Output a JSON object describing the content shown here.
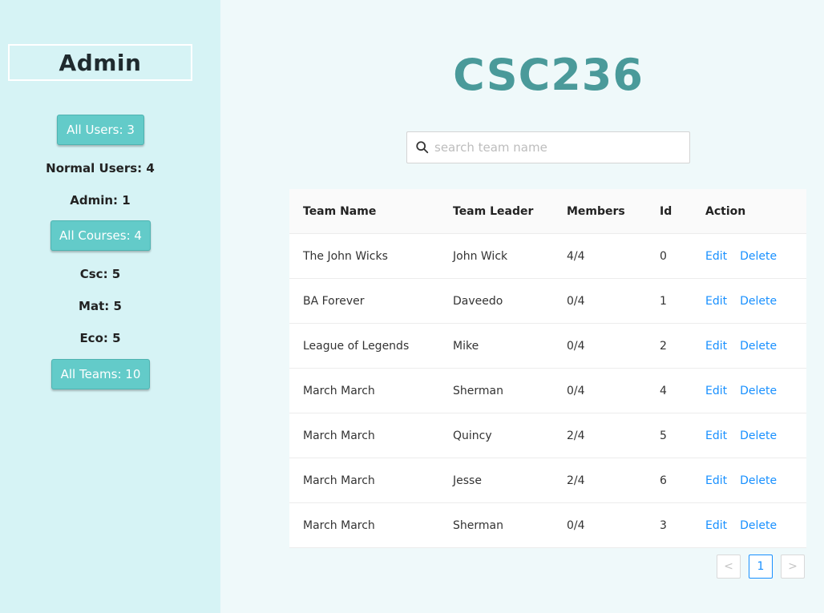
{
  "sidebar": {
    "title": "Admin",
    "all_users": "All Users: 3",
    "normal_users": "Normal Users: 4",
    "admins": "Admin: 1",
    "all_courses": "All Courses: 4",
    "courses": [
      "Csc: 5",
      "Mat: 5",
      "Eco: 5"
    ],
    "all_teams": "All Teams: 10"
  },
  "main": {
    "course_title": "CSC236",
    "search_placeholder": "search team name"
  },
  "table": {
    "columns": [
      "Team Name",
      "Team Leader",
      "Members",
      "Id",
      "Action"
    ],
    "rows": [
      {
        "team_name": "The John Wicks",
        "leader": "John Wick",
        "members": "4/4",
        "id": "0",
        "edit": "Edit",
        "delete": "Delete"
      },
      {
        "team_name": "BA Forever",
        "leader": "Daveedo",
        "members": "0/4",
        "id": "1",
        "edit": "Edit",
        "delete": "Delete"
      },
      {
        "team_name": "League of Legends",
        "leader": "Mike",
        "members": "0/4",
        "id": "2",
        "edit": "Edit",
        "delete": "Delete"
      },
      {
        "team_name": "March March",
        "leader": "Sherman",
        "members": "0/4",
        "id": "4",
        "edit": "Edit",
        "delete": "Delete"
      },
      {
        "team_name": "March March",
        "leader": "Quincy",
        "members": "2/4",
        "id": "5",
        "edit": "Edit",
        "delete": "Delete"
      },
      {
        "team_name": "March March",
        "leader": "Jesse",
        "members": "2/4",
        "id": "6",
        "edit": "Edit",
        "delete": "Delete"
      },
      {
        "team_name": "March March",
        "leader": "Sherman",
        "members": "0/4",
        "id": "3",
        "edit": "Edit",
        "delete": "Delete"
      }
    ]
  },
  "pagination": {
    "prev": "<",
    "current": "1",
    "next": ">"
  },
  "colors": {
    "sidebar_bg": "#d6f3f5",
    "page_bg": "#eff9fa",
    "button_bg": "#63cbc9",
    "title_color": "#4a9a9a",
    "link_color": "#1890ff"
  }
}
